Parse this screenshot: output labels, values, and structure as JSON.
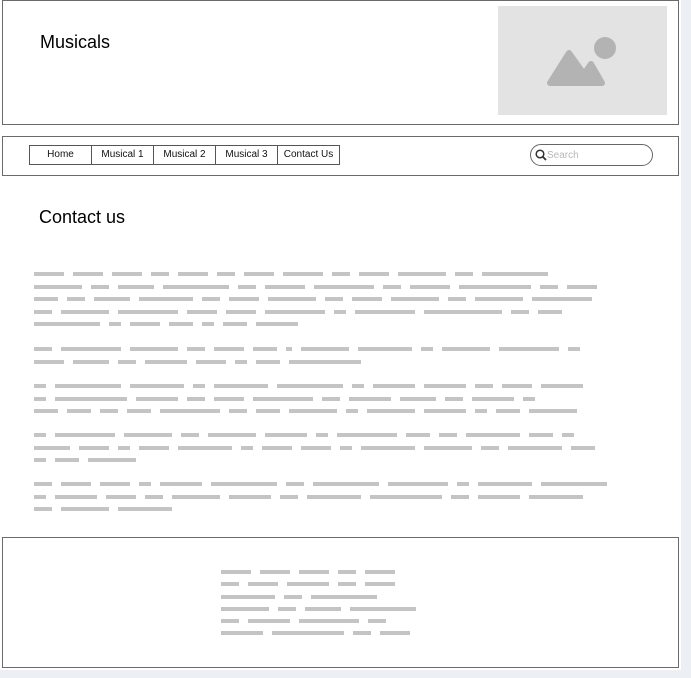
{
  "header": {
    "title": "Musicals",
    "image_icon": "image-placeholder-icon"
  },
  "nav": {
    "items": [
      {
        "label": "Home"
      },
      {
        "label": "Musical 1"
      },
      {
        "label": "Musical 2"
      },
      {
        "label": "Musical 3"
      },
      {
        "label": "Contact Us"
      }
    ],
    "search": {
      "placeholder": "Search",
      "icon": "search-icon"
    }
  },
  "main": {
    "title": "Contact us"
  },
  "colors": {
    "placeholder_text": "#c4c4c4",
    "image_fill": "#e3e3e3",
    "image_glyph": "#b3b3b3",
    "border": "#6b6b6b"
  }
}
